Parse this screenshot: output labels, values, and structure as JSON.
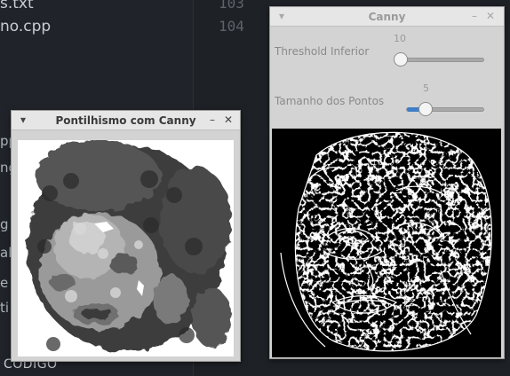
{
  "editor": {
    "files": [
      "s.txt",
      "no.cpp"
    ],
    "sidebar_fragments": [
      "pp",
      "ng",
      "g",
      "al",
      "e",
      "ti"
    ],
    "line_numbers": [
      "103",
      "104"
    ],
    "bottom_label": "CODIGO"
  },
  "window_pontilhismo": {
    "title": "Pontilhismo com Canny",
    "menu_icon": "chevron-down-icon",
    "minimize_icon": "minimize-icon",
    "close_icon": "close-icon",
    "image_desc": "pointillism-render"
  },
  "window_canny": {
    "title": "Canny",
    "menu_icon": "chevron-down-icon",
    "minimize_icon": "minimize-icon",
    "close_icon": "close-icon",
    "threshold": {
      "label": "Threshold Inferior",
      "value": "10",
      "fraction": 0.0
    },
    "point_size": {
      "label": "Tamanho dos Pontos",
      "value": "5",
      "fraction": 0.25
    }
  },
  "colors": {
    "accent": "#3d7ec8",
    "editor_bg": "#1e2126",
    "window_bg": "#d3d3d3"
  }
}
